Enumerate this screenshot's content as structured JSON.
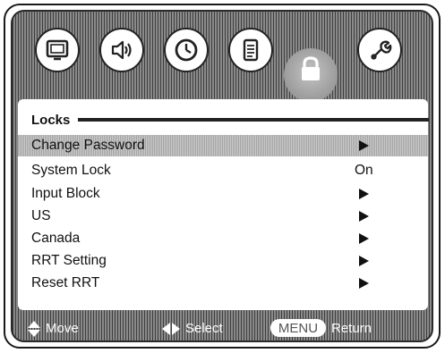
{
  "tabs": [
    {
      "name": "picture",
      "icon": "monitor-icon"
    },
    {
      "name": "audio",
      "icon": "speaker-icon"
    },
    {
      "name": "time",
      "icon": "clock-icon"
    },
    {
      "name": "setup",
      "icon": "document-icon"
    },
    {
      "name": "locks",
      "icon": "lock-icon",
      "active": true
    },
    {
      "name": "tools",
      "icon": "wrench-icon"
    }
  ],
  "menu": {
    "title": "Locks",
    "items": [
      {
        "label": "Change Password",
        "value": "",
        "arrow": true,
        "selected": true
      },
      {
        "label": "System Lock",
        "value": "On",
        "arrow": false,
        "selected": false
      },
      {
        "label": "Input Block",
        "value": "",
        "arrow": true,
        "selected": false
      },
      {
        "label": "US",
        "value": "",
        "arrow": true,
        "selected": false
      },
      {
        "label": "Canada",
        "value": "",
        "arrow": true,
        "selected": false
      },
      {
        "label": "RRT Setting",
        "value": "",
        "arrow": true,
        "selected": false
      },
      {
        "label": "Reset RRT",
        "value": "",
        "arrow": true,
        "selected": false
      }
    ]
  },
  "footer": {
    "move_label": "Move",
    "select_label": "Select",
    "menu_button_label": "MENU",
    "return_label": "Return"
  }
}
